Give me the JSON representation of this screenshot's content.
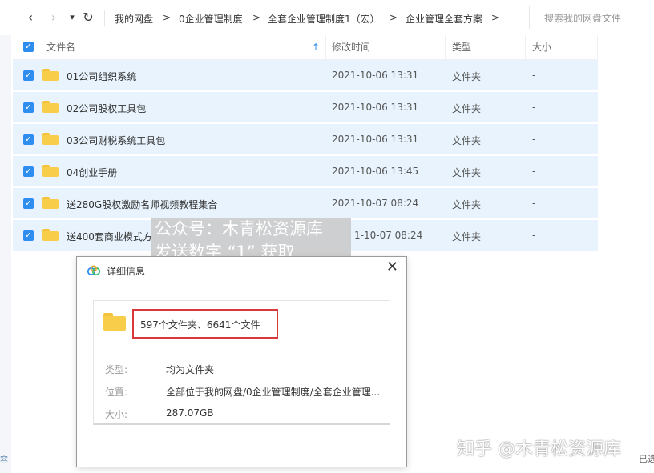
{
  "nav": {
    "back": "‹",
    "forward": "›",
    "dropdown": "▾",
    "refresh": "↻"
  },
  "breadcrumb": [
    {
      "label": "我的网盘"
    },
    {
      "label": "0企业管理制度"
    },
    {
      "label": "全套企业管理制度1（宏）"
    },
    {
      "label": "企业管理全套方案"
    }
  ],
  "breadcrumb_sep": ">",
  "search": {
    "placeholder": "搜索我的网盘文件"
  },
  "table": {
    "columns": {
      "name": "文件名",
      "sort_indicator": "↑",
      "time": "修改时间",
      "type": "类型",
      "size": "大小"
    },
    "rows": [
      {
        "name": "01公司组织系统",
        "time": "2021-10-06 13:31",
        "type": "文件夹",
        "size": "-"
      },
      {
        "name": "02公司股权工具包",
        "time": "2021-10-06 13:31",
        "type": "文件夹",
        "size": "-"
      },
      {
        "name": "03公司财税系统工具包",
        "time": "2021-10-06 13:31",
        "type": "文件夹",
        "size": "-"
      },
      {
        "name": "04创业手册",
        "time": "2021-10-06 13:45",
        "type": "文件夹",
        "size": "-"
      },
      {
        "name": "送280G股权激励名师视频教程集合",
        "time": "2021-10-07 08:24",
        "type": "文件夹",
        "size": "-"
      },
      {
        "name": "送400套商业模式方",
        "time": "1-10-07 08:24",
        "type": "文件夹",
        "size": "-"
      }
    ]
  },
  "watermark": {
    "line1": "公众号：木青松资源库",
    "line2": "发送数字 “1” 获取"
  },
  "dialog": {
    "title": "详细信息",
    "close": "✕",
    "count": "597个文件夹、6641个文件",
    "type_label": "类型:",
    "type_value": "均为文件夹",
    "location_label": "位置:",
    "location_value": "全部位于我的网盘/0企业管理制度/全套企业管理...",
    "size_label": "大小:",
    "size_value": "287.07GB"
  },
  "zhihu_watermark": "知乎 @木青松资源库",
  "left_edge_text": "容",
  "corner_text": "已选",
  "colors": {
    "selected_row": "#e8f3fd",
    "checkbox": "#2e8ef0",
    "highlight_border": "#d9383a",
    "folder": "#f8cd4a"
  }
}
